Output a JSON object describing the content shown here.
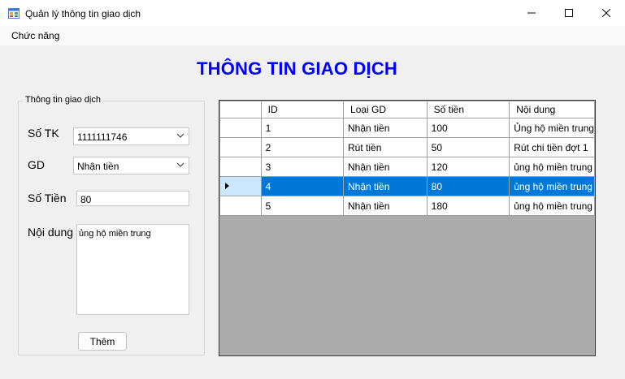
{
  "window": {
    "title": "Quản lý thông tin giao dịch",
    "icon": "app-form-icon"
  },
  "menu": {
    "items": [
      "Chức năng"
    ]
  },
  "heading": "THÔNG TIN GIAO DỊCH",
  "form": {
    "group_title": "Thông tin giao dịch",
    "so_tk_label": "Số TK",
    "so_tk_value": "1111111746",
    "gd_label": "GD",
    "gd_value": "Nhận tiền",
    "so_tien_label": "Số Tiền",
    "so_tien_value": "80",
    "noi_dung_label": "Nội dung",
    "noi_dung_value": "ủng hộ miền trung",
    "them_button": "Thêm"
  },
  "grid": {
    "columns": [
      "ID",
      "Loại GD",
      "Số tiền",
      "Nội dung"
    ],
    "rows": [
      [
        "1",
        "Nhận tiền",
        "100",
        "Ủng hộ miền trung"
      ],
      [
        "2",
        "Rút tiền",
        "50",
        "Rút chi tiền đợt 1"
      ],
      [
        "3",
        "Nhận tiền",
        "120",
        "ủng hộ miền trung"
      ],
      [
        "4",
        "Nhận tiền",
        "80",
        "ủng hộ miền trung"
      ],
      [
        "5",
        "Nhận tiền",
        "180",
        "ủng hộ miền trung"
      ]
    ],
    "selected_row": 3,
    "selection_color": "#0078d7"
  },
  "colors": {
    "heading": "#0000ff",
    "grid_background": "#ababab"
  }
}
